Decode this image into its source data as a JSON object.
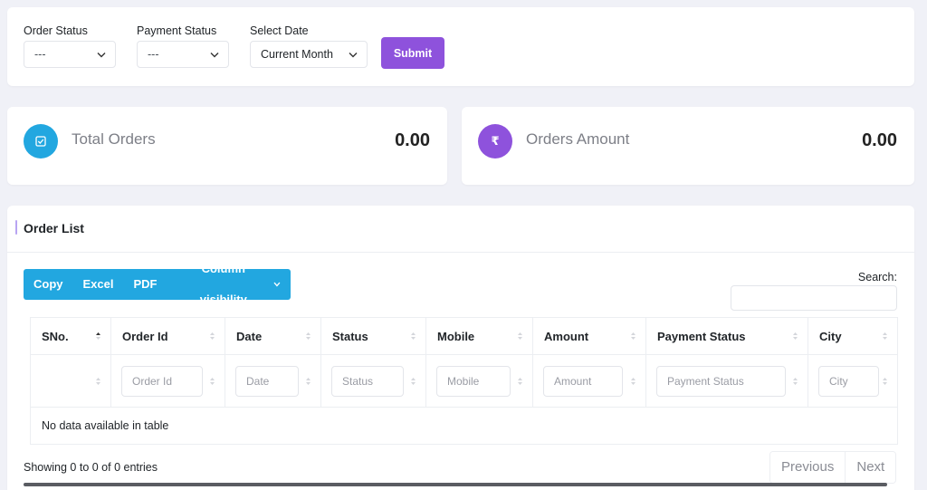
{
  "filters": {
    "order_status": {
      "label": "Order Status",
      "value": "---"
    },
    "payment_status": {
      "label": "Payment Status",
      "value": "---"
    },
    "select_date": {
      "label": "Select Date",
      "value": "Current Month"
    },
    "submit_label": "Submit"
  },
  "stats": {
    "total_orders": {
      "label": "Total Orders",
      "value": "0.00",
      "icon": "checkbox-icon",
      "color": "#22a7e0"
    },
    "orders_amount": {
      "label": "Orders Amount",
      "value": "0.00",
      "icon": "rupee-icon",
      "icon_glyph": "₹",
      "color": "#8e52dc"
    }
  },
  "order_list": {
    "title": "Order List",
    "export_buttons": [
      "Copy",
      "Excel",
      "PDF",
      "Column visibility"
    ],
    "search_label": "Search:",
    "columns": [
      "SNo.",
      "Order Id",
      "Date",
      "Status",
      "Mobile",
      "Amount",
      "Payment Status",
      "City"
    ],
    "filter_placeholders": [
      "",
      "Order Id",
      "Date",
      "Status",
      "Mobile",
      "Amount",
      "Payment Status",
      "City"
    ],
    "empty_message": "No data available in table",
    "info": "Showing 0 to 0 of 0 entries",
    "pagination": {
      "previous": "Previous",
      "next": "Next"
    }
  }
}
